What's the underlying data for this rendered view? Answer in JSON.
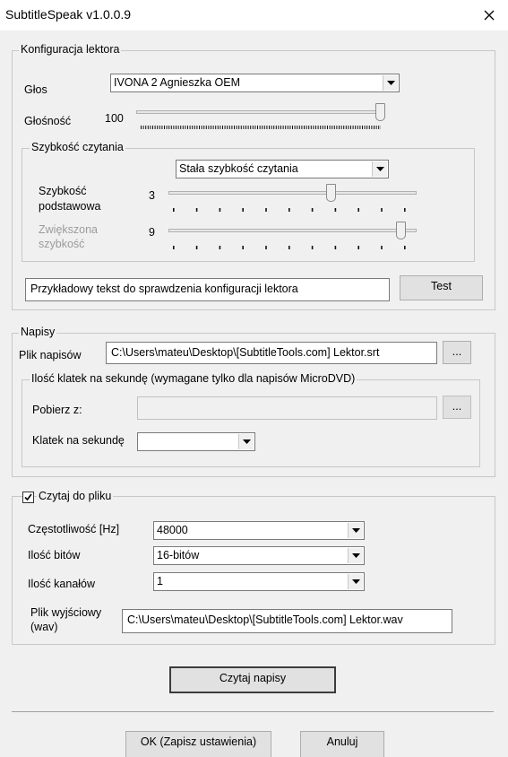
{
  "window": {
    "title": "SubtitleSpeak v1.0.0.9"
  },
  "lector": {
    "group_title": "Konfiguracja lektora",
    "voice_label": "Głos",
    "voice_value": "IVONA 2 Agnieszka OEM",
    "volume_label": "Głośność",
    "volume_value": "100",
    "volume_level": 100,
    "speed": {
      "group_title": "Szybkość czytania",
      "mode_value": "Stała szybkość czytania",
      "base_label_line1": "Szybkość",
      "base_label_line2": "podstawowa",
      "base_value": "3",
      "increased_label_line1": "Zwiększona",
      "increased_label_line2": "szybkość",
      "increased_value": "9"
    },
    "sample_text": "Przykładowy tekst do sprawdzenia konfiguracji lektora",
    "test_button": "Test"
  },
  "subtitles": {
    "group_title": "Napisy",
    "file_label": "Plik napisów",
    "file_value": "C:\\Users\\mateu\\Desktop\\[SubtitleTools.com] Lektor.srt",
    "browse_label": "...",
    "fps": {
      "group_title": "Ilość klatek na sekundę (wymagane tylko dla napisów MicroDVD)",
      "source_label": "Pobierz z:",
      "source_value": "",
      "browse_label": "...",
      "fps_label": "Klatek na sekundę",
      "fps_value": ""
    }
  },
  "output": {
    "checkbox_label": "Czytaj do pliku",
    "checked": true,
    "frequency_label": "Częstotliwość [Hz]",
    "frequency_value": "48000",
    "bits_label": "Ilość bitów",
    "bits_value": "16-bitów",
    "channels_label": "Ilość kanałów",
    "channels_value": "1",
    "outfile_label_line1": "Plik wyjściowy",
    "outfile_label_line2": "(wav)",
    "outfile_value": "C:\\Users\\mateu\\Desktop\\[SubtitleTools.com] Lektor.wav"
  },
  "actions": {
    "read_button": "Czytaj napisy",
    "ok_button": "OK (Zapisz ustawienia)",
    "cancel_button": "Anuluj"
  },
  "icons": {
    "close": "close-icon",
    "dropdown": "chevron-down-icon",
    "check": "checkmark-icon"
  }
}
